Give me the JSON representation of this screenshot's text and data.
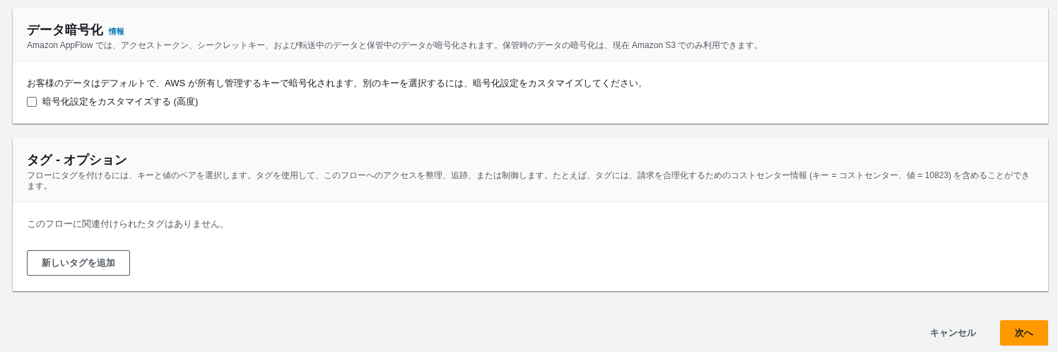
{
  "sections": [
    {
      "kind": "encryption",
      "title": "データ暗号化",
      "info_link": "情報",
      "description": "Amazon AppFlow では、アクセストークン、シークレットキー、および転送中のデータと保管中のデータが暗号化されます。保管時のデータの暗号化は、現在 Amazon S3 でのみ利用できます。",
      "body_text": "お客様のデータはデフォルトで、AWS が所有し管理するキーで暗号化されます。別のキーを選択するには、暗号化設定をカスタマイズしてください。",
      "checkbox": {
        "label": "暗号化設定をカスタマイズする (高度)",
        "checked": false
      }
    },
    {
      "kind": "tags",
      "title": "タグ - オプション",
      "description": "フローにタグを付けるには、キーと値のペアを選択します。タグを使用して、このフローへのアクセスを整理、追跡、または制御します。たとえば、タグには、請求を合理化するためのコストセンター情報 (キー = コストセンター、値 = 10823) を含めることができます。",
      "body_text": "このフローに関連付けられたタグはありません。",
      "button": "新しいタグを追加"
    }
  ],
  "footer": {
    "cancel": "キャンセル",
    "next": "次へ"
  }
}
